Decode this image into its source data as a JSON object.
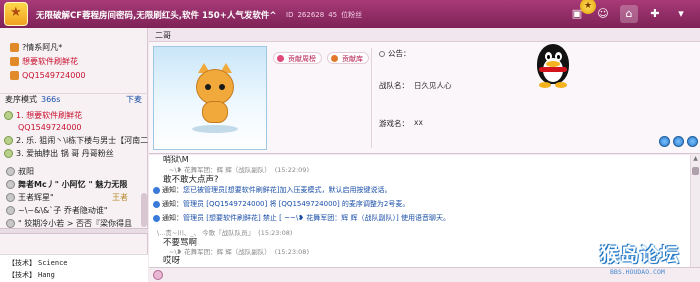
{
  "titlebar": {
    "title": "无限破解CF蓉程房间密码,无限刷红头,软件 150+人气发软件^",
    "id_label": "ID",
    "id_value": "262628",
    "count": "45",
    "fans_label": "位粉丝",
    "icons": [
      "picture-icon",
      "medal-icon",
      "home-icon",
      "tools-icon",
      "chevron-down-icon"
    ]
  },
  "sidebar": {
    "top": [
      {
        "icon": "house-icon",
        "text": "?情系阿凡*"
      },
      {
        "icon": "house-icon",
        "text": "想要软件刷鲜花"
      },
      {
        "icon": "house-icon",
        "text": "QQ1549724000"
      }
    ],
    "mode_label": "麦序模式",
    "mode_count": "366s",
    "down_label": "下麦",
    "queue": [
      {
        "text": "1. 想要软件刷鲜花"
      },
      {
        "text": "QQ1549724000"
      },
      {
        "text": "2. 乐. 狙闹丶\\i栋下楼与男士【河南二区"
      },
      {
        "text": "3. 爱抽脖出  锅  哥  丹哥粉丝"
      }
    ],
    "members": [
      {
        "text": "叔阳"
      },
      {
        "text": "舞者Mc丿\" 小阿忆 \" 魅力无限"
      },
      {
        "text": "王者辉星\""
      },
      {
        "text": "~\\~&\\&`子 乔者隐动谁\""
      },
      {
        "text": "\" 狡期冷小若 > 否否『梁你得且"
      }
    ],
    "side_tag": "王者",
    "details": [
      {
        "label": "【技术】",
        "value": "Science"
      },
      {
        "label": "【技术】",
        "value": "Hang ug"
      }
    ]
  },
  "main": {
    "channel_name": "二哥",
    "pills": [
      "贡献周榜",
      "贡献库"
    ],
    "announcement_label": "公告：",
    "team_label": "战队名：",
    "team_value": "日久见人心",
    "game_label": "游戏名：",
    "game_value": "xx"
  },
  "chat": {
    "line1": "哨狱\\M",
    "line2": "敢不敢大点声?",
    "sys1_prefix": "通知：",
    "sys1_text": "您已被管理员[想要软件刷鲜花]加入压麦模式，默认启用按键说话。",
    "sys2_prefix": "通知：",
    "sys2_text": "管理员 [QQ1549724000] 将 [QQ1549724000] 的麦序调整为2号麦。",
    "sys3_prefix": "通知：",
    "sys3_text": "管理员 [想要软件刷鲜花] 禁止 [ ~~\\❥ 花舞军团：辉 辉（战队副队）] 使用语音聊天。",
    "meta1_name": "~\\❥ 花舞军团：辉 辉（战队副队）",
    "meta1_time": "(15:22:09)",
    "meta2_name": "\\...贵~川、_、 今歌『战队队员』",
    "meta2_time": "(15:23:08)",
    "line3": "不要骂啊",
    "meta3_name": "~\\❥ 花舞军团：辉 辉（战队副队）",
    "meta3_time": "(15:23:08)",
    "line4": "哎呀"
  },
  "watermark": {
    "title": "猴岛论坛",
    "url": "BBS.HOUDAO.COM"
  },
  "colors": {
    "titlebar": "#8e2a63",
    "accent_red": "#c8102e",
    "link_blue": "#1a4fa8"
  }
}
